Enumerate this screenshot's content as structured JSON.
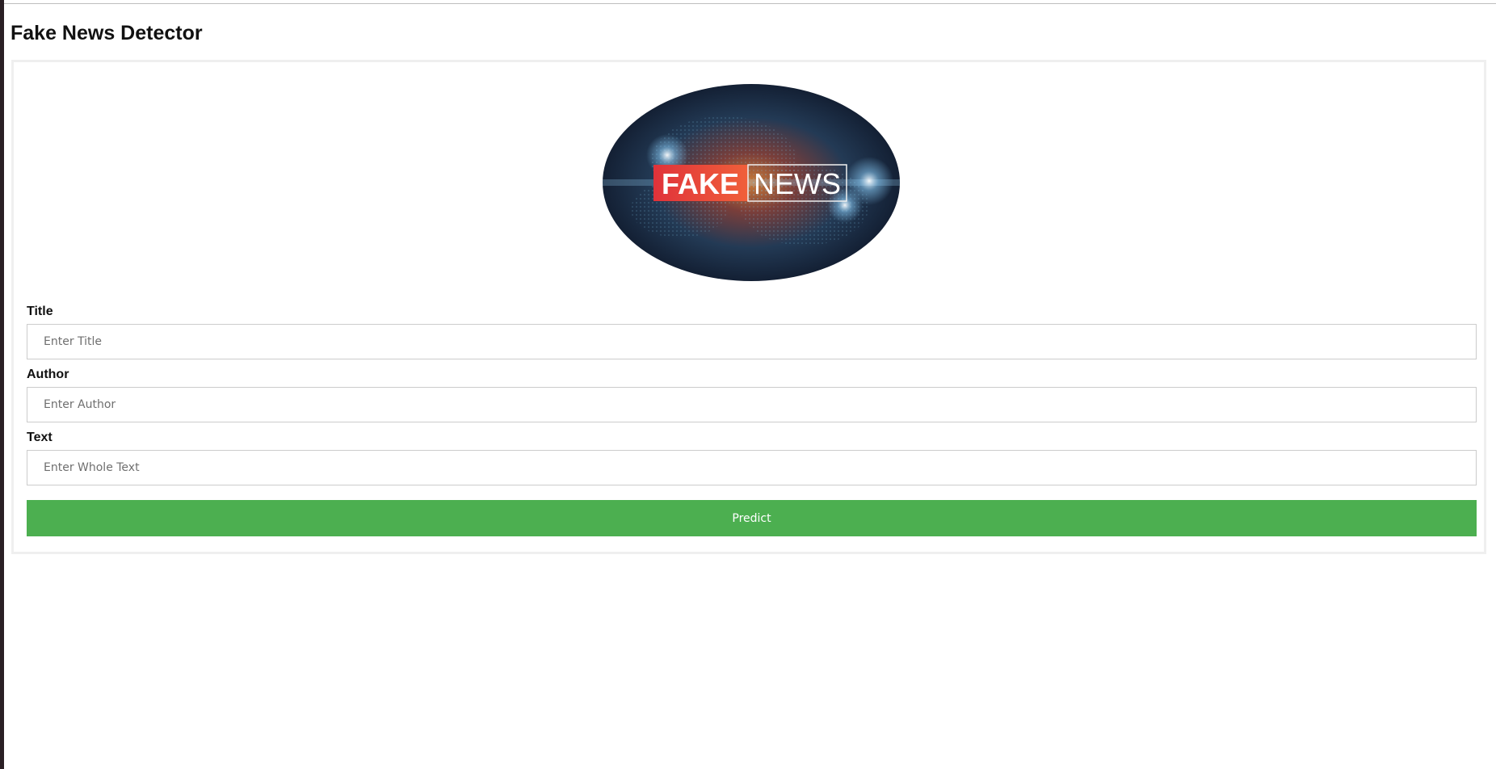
{
  "header": {
    "title": "Fake News Detector"
  },
  "logo": {
    "text_left": "FAKE",
    "text_right": "NEWS"
  },
  "form": {
    "fields": [
      {
        "label": "Title",
        "placeholder": "Enter Title",
        "value": ""
      },
      {
        "label": "Author",
        "placeholder": "Enter Author",
        "value": ""
      },
      {
        "label": "Text",
        "placeholder": "Enter Whole Text",
        "value": ""
      }
    ],
    "submit_label": "Predict"
  },
  "colors": {
    "button": "#4caf50",
    "logo_red": "#e53935"
  }
}
